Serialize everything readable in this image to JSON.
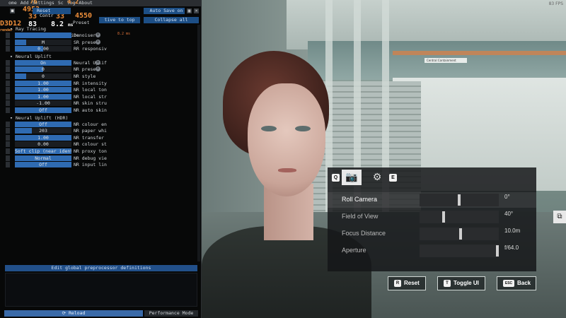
{
  "debug_panel": {
    "menu": [
      "ome",
      "Add",
      "Settings",
      "Sc",
      "log",
      "About"
    ],
    "overlays": {
      "fps_top": "76",
      "fps_b": "4.2",
      "frames": "4952",
      "frame_time": "33",
      "frame_count": "4550",
      "api": "D3D12",
      "present_rate": "83",
      "ms_value": "8.2",
      "ms_unit": "ms",
      "render_small": "render"
    },
    "toolbar": {
      "reset_label": "Reset",
      "auto_save_label": "Auto Save on",
      "control_label": "Contr",
      "scroll_top_label": "tive to top",
      "collapse_label": "Collapse all",
      "preset_label": "Preset"
    },
    "sections": [
      {
        "title": "Ray Tracing",
        "subtitle": "DLSS Ray Reconstruction",
        "rows": [
          {
            "value": "",
            "label": "Denoiser",
            "fill": 1.0
          },
          {
            "value": "M",
            "label": "SR preset",
            "fill": 0.2
          },
          {
            "value": "0.00",
            "label": "RR responsiv",
            "fill": 0.5
          }
        ]
      },
      {
        "title": "Neural Uplift",
        "rows": [
          {
            "value": "On",
            "label": "Neural Uplif",
            "fill": 1.0
          },
          {
            "value": "0",
            "label": "NR preset",
            "fill": 0.5
          },
          {
            "value": "0",
            "label": "NR style",
            "fill": 0.2
          },
          {
            "value": "1.00",
            "label": "NR intensity",
            "fill": 1.0
          },
          {
            "value": "1.00",
            "label": "NR local ton",
            "fill": 1.0
          },
          {
            "value": "1.00",
            "label": "NR local str",
            "fill": 1.0
          },
          {
            "value": "-1.00",
            "label": "NR skin stru",
            "fill": 0.0
          },
          {
            "value": "Off",
            "label": "NR auto skin",
            "fill": 1.0
          }
        ]
      },
      {
        "title": "Neural Uplift (HDR)",
        "rows": [
          {
            "value": "Off",
            "label": "NR colour en",
            "fill": 1.0
          },
          {
            "value": "203",
            "label": "NR paper whi",
            "fill": 0.3
          },
          {
            "value": "1.00",
            "label": "NR transfer",
            "fill": 1.0
          },
          {
            "value": "0.00",
            "label": "NR colour st",
            "fill": 0.0
          },
          {
            "value": "Soft clip (near identity)",
            "label": "NR proxy ton",
            "fill": 1.0
          },
          {
            "value": "Normal",
            "label": "NR debug vie",
            "fill": 1.0
          },
          {
            "value": "Off",
            "label": "NR input lin",
            "fill": 1.0
          }
        ]
      }
    ],
    "denoiser_timing": "8.2 ms",
    "preprocessor_button": "Edit global preprocessor definitions",
    "reload_label": "Reload",
    "performance_mode_label": "Performance Mode"
  },
  "photo_mode": {
    "tab_keys": {
      "left": "Q",
      "right": "E"
    },
    "tabs": [
      {
        "icon": "camera-icon",
        "glyph": "📷",
        "active": true
      },
      {
        "icon": "filter-icon",
        "glyph": "⚙",
        "active": false
      }
    ],
    "rows": [
      {
        "label": "Roll Camera",
        "value": "0°",
        "position": 0.5
      },
      {
        "label": "Field of View",
        "value": "40°",
        "position": 0.3
      },
      {
        "label": "Focus Distance",
        "value": "10.0m",
        "position": 0.52
      },
      {
        "label": "Aperture",
        "value": "f/64.0",
        "position": 1.0
      }
    ],
    "selected_row": 0,
    "buttons": [
      {
        "key": "R",
        "label": "Reset"
      },
      {
        "key": "T",
        "label": "Toggle UI"
      },
      {
        "key": "ESC",
        "label": "Back"
      }
    ],
    "screenshot_icon": "screenshot-icon",
    "corner_text": "83 FPS"
  },
  "scene": {
    "sign_text": "Central Containment"
  }
}
